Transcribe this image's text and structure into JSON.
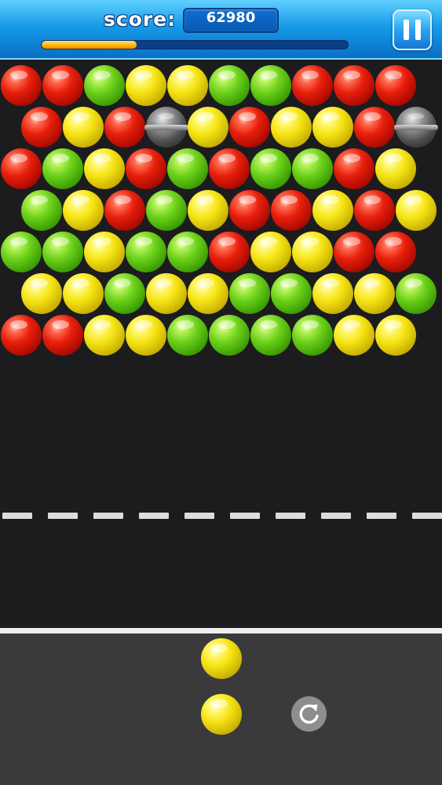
{
  "header": {
    "score_label": "score:",
    "score_value": "62980",
    "progress": 0.31,
    "pause_icon": "pause-icon"
  },
  "colors": {
    "red": "#e81f0c",
    "green": "#6cd11a",
    "yellow": "#f6e514",
    "metal": "#7a7a7a",
    "header": "#169be8",
    "board": "#1c1c1e"
  },
  "board": {
    "rows": [
      [
        "red",
        "red",
        "green",
        "yellow",
        "yellow",
        "green",
        "green",
        "red",
        "red",
        "red"
      ],
      [
        "red",
        "yellow",
        "red",
        "metal",
        "yellow",
        "red",
        "yellow",
        "yellow",
        "red",
        "metal"
      ],
      [
        "red",
        "green",
        "yellow",
        "red",
        "green",
        "red",
        "green",
        "green",
        "red",
        "yellow"
      ],
      [
        "green",
        "yellow",
        "red",
        "green",
        "yellow",
        "red",
        "red",
        "yellow",
        "red",
        "yellow"
      ],
      [
        "green",
        "green",
        "yellow",
        "green",
        "green",
        "red",
        "yellow",
        "yellow",
        "red",
        "red"
      ],
      [
        "yellow",
        "yellow",
        "green",
        "yellow",
        "yellow",
        "green",
        "green",
        "yellow",
        "yellow",
        "green"
      ],
      [
        "red",
        "red",
        "yellow",
        "yellow",
        "green",
        "green",
        "green",
        "green",
        "yellow",
        "yellow"
      ]
    ]
  },
  "launcher": {
    "next_bubble": "yellow",
    "current_bubble": "yellow",
    "swap_icon": "refresh-icon"
  }
}
